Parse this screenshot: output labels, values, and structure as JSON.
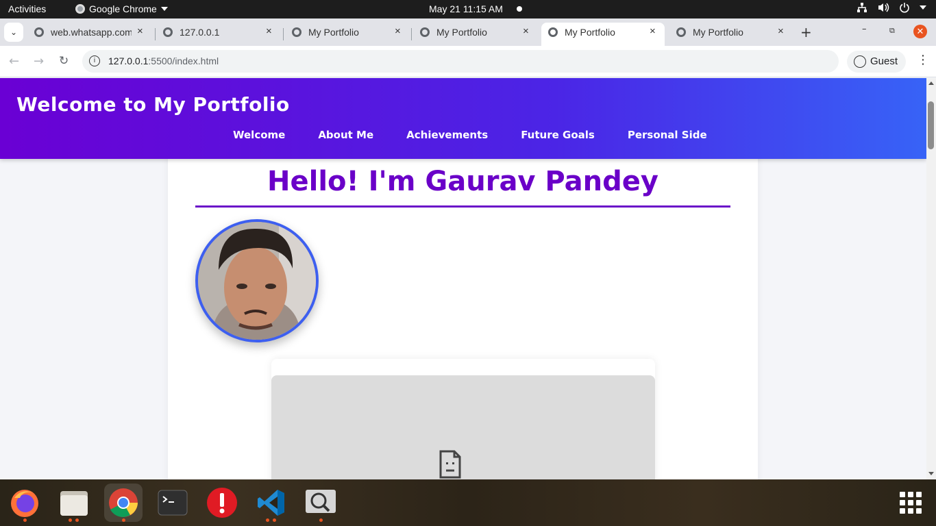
{
  "system_bar": {
    "activities": "Activities",
    "app_name": "Google Chrome",
    "clock": "May 21  11:15 AM"
  },
  "browser": {
    "tabs": [
      {
        "title": "web.whatsapp.com",
        "active": false
      },
      {
        "title": "127.0.0.1",
        "active": false
      },
      {
        "title": "My Portfolio",
        "active": false
      },
      {
        "title": "My Portfolio",
        "active": false
      },
      {
        "title": "My Portfolio",
        "active": true
      },
      {
        "title": "My Portfolio",
        "active": false
      }
    ],
    "url_host": "127.0.0.1",
    "url_rest": ":5500/index.html",
    "profile_label": "Guest"
  },
  "site": {
    "title": "Welcome to My Portfolio",
    "nav": [
      "Welcome",
      "About Me",
      "Achievements",
      "Future Goals",
      "Personal Side"
    ],
    "hero_heading": "Hello! I'm Gaurav Pandey",
    "accent_colors": {
      "header_start": "#6a00d4",
      "header_end": "#3763f7",
      "heading": "#6a00c8",
      "avatar_ring": "#3d5ff0"
    }
  },
  "dock": {
    "apps": [
      {
        "name": "Firefox",
        "icon": "firefox-icon"
      },
      {
        "name": "Files",
        "icon": "files-icon"
      },
      {
        "name": "Google Chrome",
        "icon": "chrome-icon"
      },
      {
        "name": "Terminal",
        "icon": "terminal-icon"
      },
      {
        "name": "Software Updater",
        "icon": "alert-icon"
      },
      {
        "name": "Visual Studio Code",
        "icon": "vscode-icon"
      },
      {
        "name": "Image Viewer",
        "icon": "search-image-icon"
      }
    ]
  }
}
